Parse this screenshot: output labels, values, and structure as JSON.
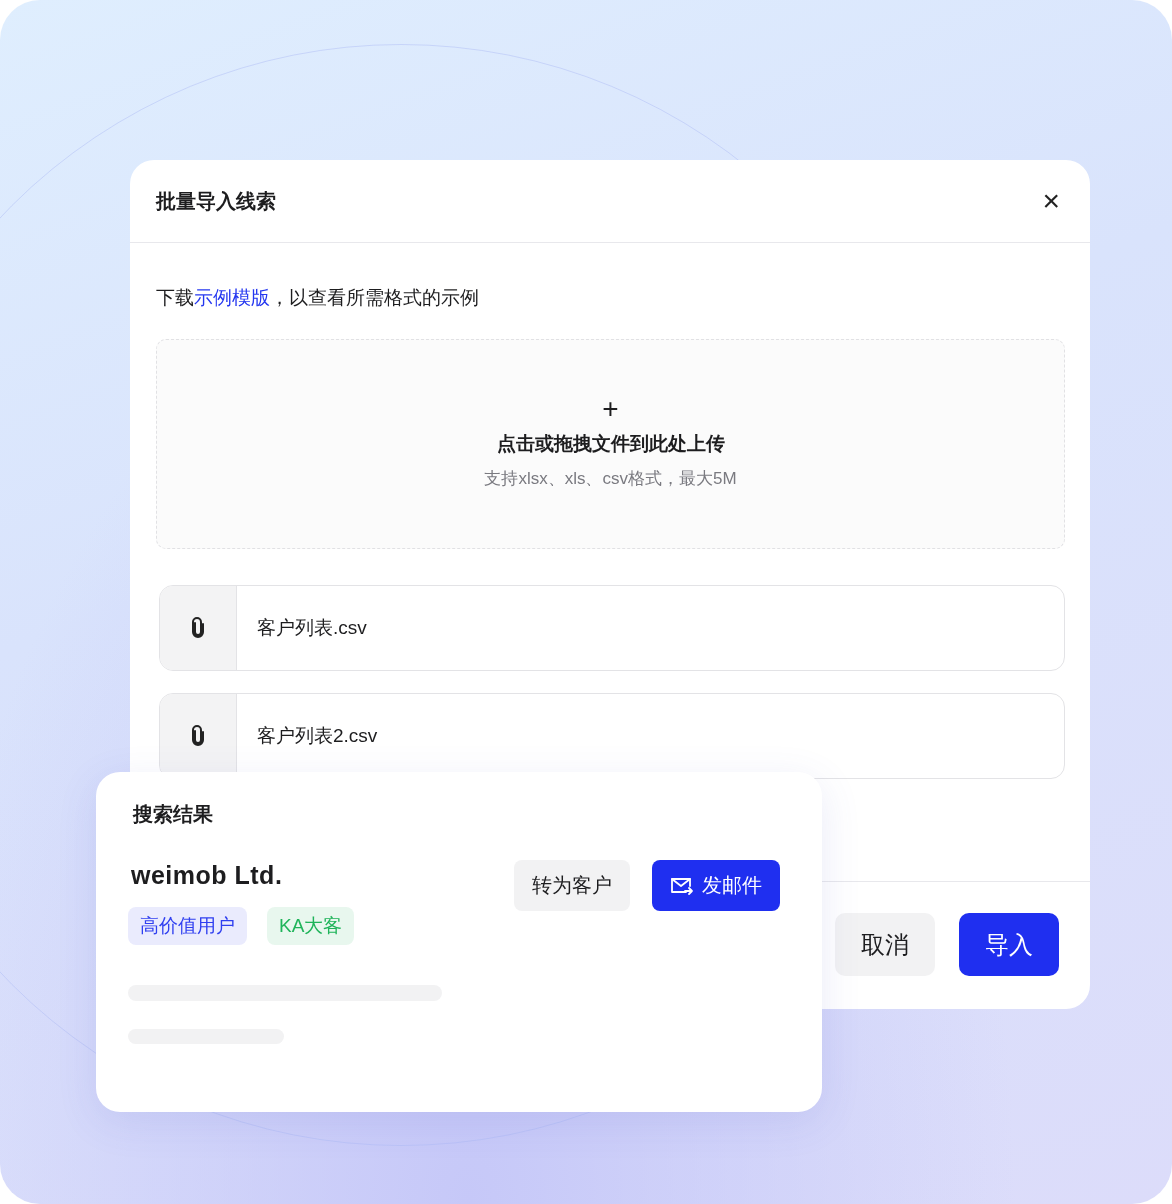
{
  "dialog": {
    "title": "批量导入线索",
    "close": "×",
    "intro": {
      "before": "下载",
      "link": "示例模版",
      "after": "，以查看所需格式的示例"
    },
    "upload": {
      "plus": "+",
      "title": "点击或拖拽文件到此处上传",
      "hint": "支持xlsx、xls、csv格式，最大5M"
    },
    "files": [
      {
        "name": "客户列表.csv"
      },
      {
        "name": "客户列表2.csv"
      }
    ],
    "buttons": [
      {
        "label": "取消",
        "kind": "secondary"
      },
      {
        "label": "导入",
        "kind": "primary"
      }
    ]
  },
  "search_result": {
    "title": "搜索结果",
    "company": "weimob Ltd.",
    "tags": [
      {
        "label": "高价值用户",
        "color": "#2f3ff0"
      },
      {
        "label": "KA大客",
        "color": "#1fb45a"
      }
    ],
    "actions": [
      {
        "label": "转为客户",
        "kind": "secondary"
      },
      {
        "label": "发邮件",
        "kind": "primary-mail"
      }
    ]
  }
}
